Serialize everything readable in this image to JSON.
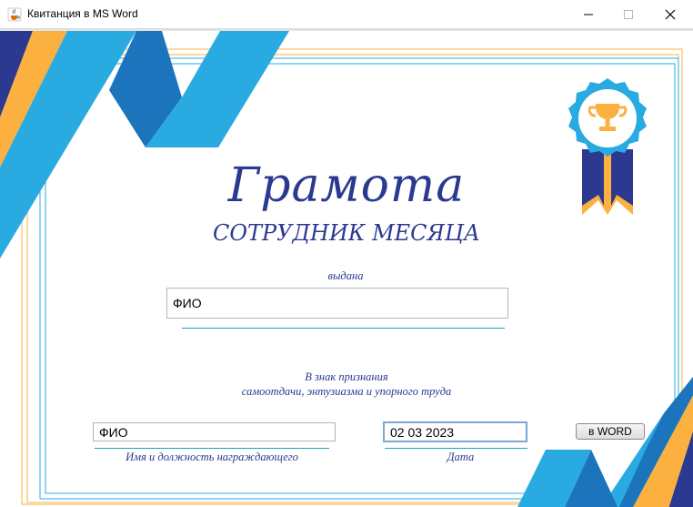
{
  "window": {
    "title": "Квитанция в MS Word",
    "icon": "java-cup-icon"
  },
  "certificate": {
    "title": "Грамота",
    "subtitle": "СОТРУДНИК МЕСЯЦА",
    "issued_label": "выдана",
    "recipient_value": "ФИО",
    "recognition_line1": "В знак признания",
    "recognition_line2": "самоотдачи, энтузиазма и упорного труда",
    "awarder_value": "ФИО",
    "awarder_label": "Имя и должность награждающего",
    "date_value": "02 03 2023",
    "date_label": "Дата",
    "export_button": "в WORD"
  },
  "colors": {
    "navy": "#2b3990",
    "light_blue": "#29abe2",
    "mid_blue": "#1c75bc",
    "gold": "#fbb040",
    "teal": "#1aa5b8"
  }
}
